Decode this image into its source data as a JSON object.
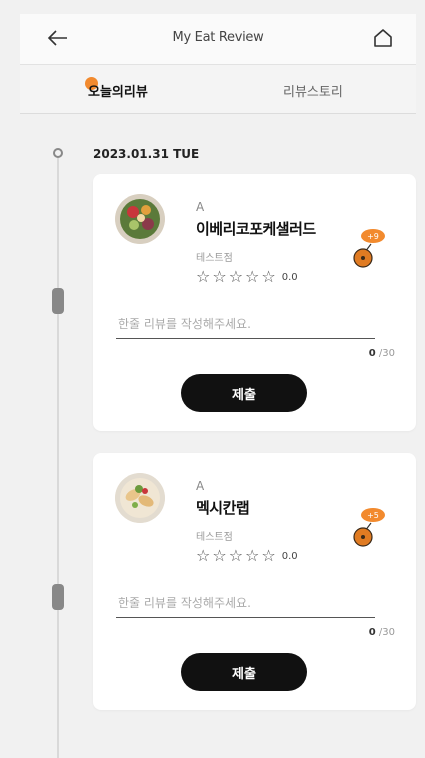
{
  "header": {
    "title": "My Eat Review",
    "back_icon": "arrow-left-icon",
    "home_icon": "home-icon"
  },
  "tabs": [
    {
      "label": "오늘의리뷰",
      "active": true
    },
    {
      "label": "리뷰스토리",
      "active": false
    }
  ],
  "timeline": {
    "date": "2023.01.31 TUE"
  },
  "cards": [
    {
      "store": "A",
      "menu": "이베리코포케샐러드",
      "branch": "테스트점",
      "rating": "0.0",
      "star_count": 5,
      "badge_text": "+9",
      "review_placeholder": "한줄 리뷰를 작성해주세요.",
      "char_count": "0",
      "char_max": "/30",
      "submit_label": "제출"
    },
    {
      "store": "A",
      "menu": "멕시칸랩",
      "branch": "테스트점",
      "rating": "0.0",
      "star_count": 5,
      "badge_text": "+5",
      "review_placeholder": "한줄 리뷰를 작성해주세요.",
      "char_count": "0",
      "char_max": "/30",
      "submit_label": "제출"
    }
  ],
  "colors": {
    "accent": "#f28a2e",
    "button_bg": "#111111",
    "background": "#f1f1f1"
  }
}
